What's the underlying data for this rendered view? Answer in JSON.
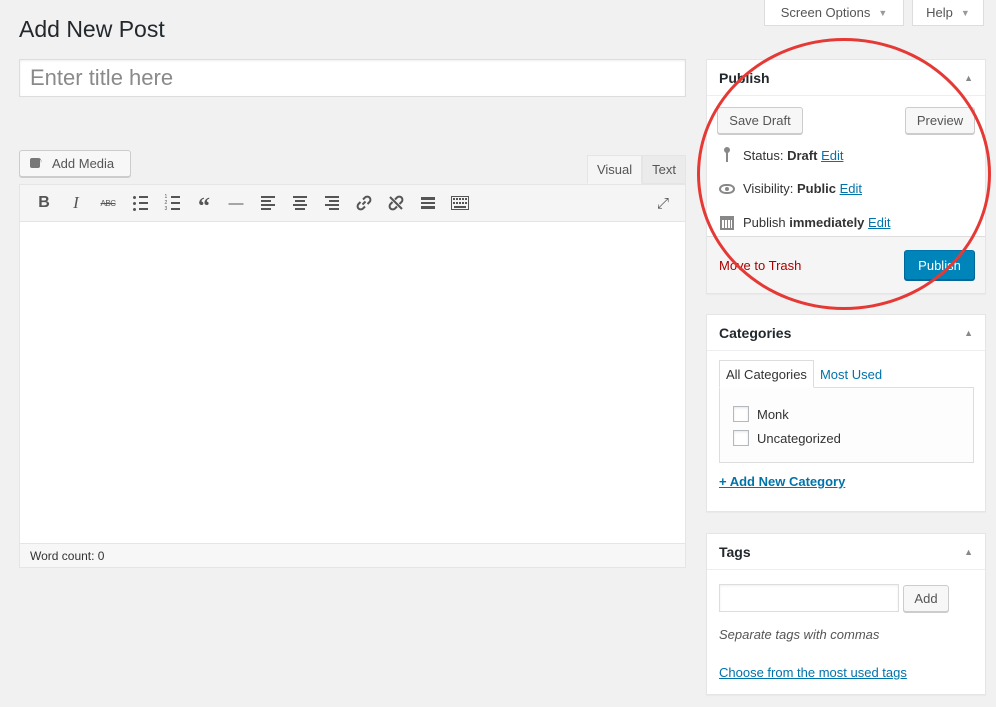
{
  "header": {
    "screen_options": "Screen Options",
    "help": "Help"
  },
  "page_title": "Add New Post",
  "title_field": {
    "placeholder": "Enter title here",
    "value": ""
  },
  "editor": {
    "add_media": "Add Media",
    "tabs": {
      "visual": "Visual",
      "text": "Text"
    },
    "active_tab": "Visual",
    "toolbar_icons": [
      "bold-icon",
      "italic-icon",
      "strikethrough-icon",
      "bullet-list-icon",
      "numbered-list-icon",
      "blockquote-icon",
      "horizontal-rule-icon",
      "align-left-icon",
      "align-center-icon",
      "align-right-icon",
      "link-icon",
      "unlink-icon",
      "read-more-icon",
      "toolbar-toggle-icon",
      "fullscreen-icon"
    ],
    "toolbar_glyphs": {
      "bold": "B",
      "italic": "I",
      "strike": "ABC",
      "quote": "“",
      "hr": "—",
      "link": "🔗",
      "unlink": "✂",
      "fullscreen": "⤢"
    },
    "word_count": "Word count: 0"
  },
  "publish": {
    "title": "Publish",
    "save_draft": "Save Draft",
    "preview": "Preview",
    "status_label": "Status:",
    "status_value": "Draft",
    "visibility_label": "Visibility:",
    "visibility_value": "Public",
    "publish_label": "Publish",
    "publish_value": "immediately",
    "edit": "Edit",
    "move_to_trash": "Move to Trash",
    "publish_button": "Publish"
  },
  "categories": {
    "title": "Categories",
    "tabs": {
      "all": "All Categories",
      "most_used": "Most Used"
    },
    "items": [
      {
        "label": "Monk",
        "checked": false
      },
      {
        "label": "Uncategorized",
        "checked": false
      }
    ],
    "add_new": "+ Add New Category"
  },
  "tags": {
    "title": "Tags",
    "input_value": "",
    "add_button": "Add",
    "hint": "Separate tags with commas",
    "choose_link": "Choose from the most used tags"
  },
  "colors": {
    "primary_blue": "#0085ba",
    "link_blue": "#0073aa",
    "trash_red": "#aa0000",
    "annotation_red": "#e53935"
  }
}
